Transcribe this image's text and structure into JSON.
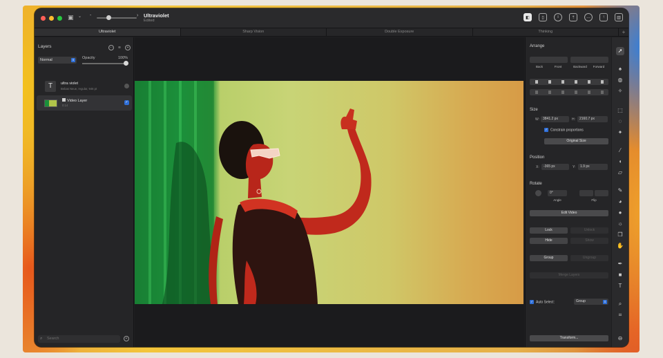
{
  "window": {
    "doc_title": "Ultraviolet",
    "doc_subtitle": "Edited"
  },
  "tabs": [
    "Ultraviolet",
    "Sharp Vision",
    "Double Exposure",
    "Thinking"
  ],
  "layers_panel": {
    "title": "Layers",
    "blend_mode": "Normal",
    "opacity_label": "Opacity",
    "opacity_value": "100%",
    "opacity_fraction": 1.0,
    "layers": [
      {
        "name": "ultra violet",
        "desc": "Bebas Neue, regular, 946 pt",
        "type": "text",
        "selected": false
      },
      {
        "name": "Video Layer",
        "desc": "0:14",
        "type": "video",
        "selected": true,
        "checked": true
      }
    ],
    "search_placeholder": "Search"
  },
  "arrange": {
    "title": "Arrange",
    "order_buttons": [
      "Back",
      "Front",
      "Backward",
      "Forward"
    ],
    "size_title": "Size",
    "width_label": "W:",
    "width_value": "3841.2 px",
    "height_label": "H:",
    "height_value": "2160.7 px",
    "constrain_label": "Constrain proportions",
    "original_size_button": "Original Size",
    "position_title": "Position",
    "x_label": "X:",
    "x_value": "-365 px",
    "y_label": "Y:",
    "y_value": "1.9 px",
    "rotate_title": "Rotate",
    "angle_value": "0°",
    "angle_label": "Angle",
    "flip_label": "Flip",
    "edit_video_button": "Edit Video",
    "lock_button": "Lock",
    "unlock_button": "Unlock",
    "hide_button": "Hide",
    "show_button": "Show",
    "group_button": "Group",
    "ungroup_button": "Ungroup",
    "merge_button": "Merge Layers",
    "auto_select_label": "Auto Select:",
    "auto_select_value": "Group",
    "transform_button": "Transform..."
  },
  "tool_icons": [
    "arrow-select-icon",
    "paint-bucket-icon",
    "smudge-icon",
    "retouch-icon",
    "rect-select-icon",
    "lasso-icon",
    "magic-wand-icon",
    "brush-icon",
    "bucket-icon",
    "eraser-icon",
    "pencil-icon",
    "color-adjust-icon",
    "blur-icon",
    "sun-icon",
    "clone-icon",
    "hand-icon",
    "pen-icon",
    "shapes-icon",
    "text-icon",
    "zoom-icon",
    "crop-icon",
    "more-icon"
  ]
}
